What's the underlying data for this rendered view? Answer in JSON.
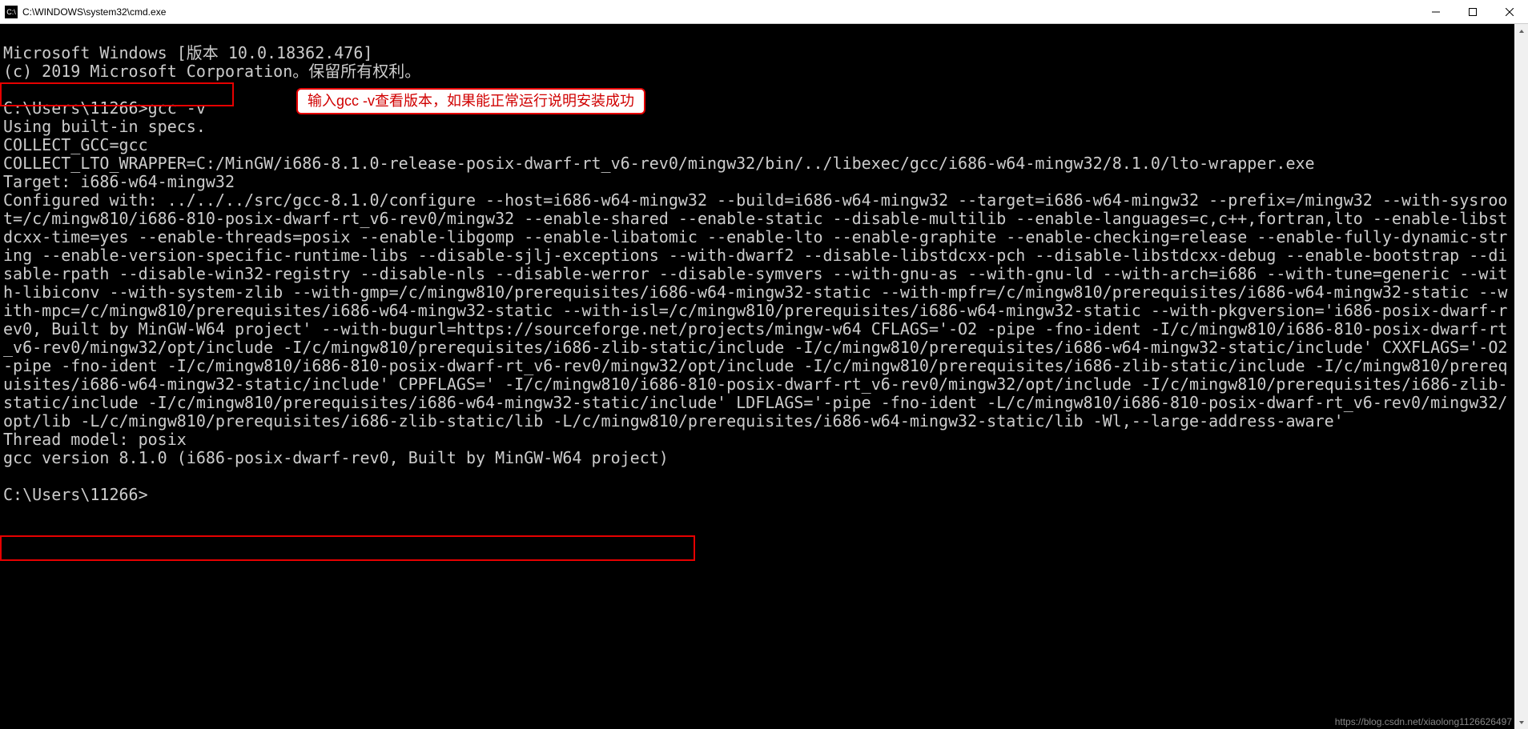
{
  "window": {
    "title": "C:\\WINDOWS\\system32\\cmd.exe",
    "icon_label": "C:\\"
  },
  "terminal": {
    "line_header1": "Microsoft Windows [版本 10.0.18362.476]",
    "line_header2": "(c) 2019 Microsoft Corporation。保留所有权利。",
    "blank": "",
    "prompt1": "C:\\Users\\11266>gcc -v",
    "specs": "Using built-in specs.",
    "collect_gcc": "COLLECT_GCC=gcc",
    "collect_lto": "COLLECT_LTO_WRAPPER=C:/MinGW/i686-8.1.0-release-posix-dwarf-rt_v6-rev0/mingw32/bin/../libexec/gcc/i686-w64-mingw32/8.1.0/lto-wrapper.exe",
    "target": "Target: i686-w64-mingw32",
    "configured": "Configured with: ../../../src/gcc-8.1.0/configure --host=i686-w64-mingw32 --build=i686-w64-mingw32 --target=i686-w64-mingw32 --prefix=/mingw32 --with-sysroot=/c/mingw810/i686-810-posix-dwarf-rt_v6-rev0/mingw32 --enable-shared --enable-static --disable-multilib --enable-languages=c,c++,fortran,lto --enable-libstdcxx-time=yes --enable-threads=posix --enable-libgomp --enable-libatomic --enable-lto --enable-graphite --enable-checking=release --enable-fully-dynamic-string --enable-version-specific-runtime-libs --disable-sjlj-exceptions --with-dwarf2 --disable-libstdcxx-pch --disable-libstdcxx-debug --enable-bootstrap --disable-rpath --disable-win32-registry --disable-nls --disable-werror --disable-symvers --with-gnu-as --with-gnu-ld --with-arch=i686 --with-tune=generic --with-libiconv --with-system-zlib --with-gmp=/c/mingw810/prerequisites/i686-w64-mingw32-static --with-mpfr=/c/mingw810/prerequisites/i686-w64-mingw32-static --with-mpc=/c/mingw810/prerequisites/i686-w64-mingw32-static --with-isl=/c/mingw810/prerequisites/i686-w64-mingw32-static --with-pkgversion='i686-posix-dwarf-rev0, Built by MinGW-W64 project' --with-bugurl=https://sourceforge.net/projects/mingw-w64 CFLAGS='-O2 -pipe -fno-ident -I/c/mingw810/i686-810-posix-dwarf-rt_v6-rev0/mingw32/opt/include -I/c/mingw810/prerequisites/i686-zlib-static/include -I/c/mingw810/prerequisites/i686-w64-mingw32-static/include' CXXFLAGS='-O2 -pipe -fno-ident -I/c/mingw810/i686-810-posix-dwarf-rt_v6-rev0/mingw32/opt/include -I/c/mingw810/prerequisites/i686-zlib-static/include -I/c/mingw810/prerequisites/i686-w64-mingw32-static/include' CPPFLAGS=' -I/c/mingw810/i686-810-posix-dwarf-rt_v6-rev0/mingw32/opt/include -I/c/mingw810/prerequisites/i686-zlib-static/include -I/c/mingw810/prerequisites/i686-w64-mingw32-static/include' LDFLAGS='-pipe -fno-ident -L/c/mingw810/i686-810-posix-dwarf-rt_v6-rev0/mingw32/opt/lib -L/c/mingw810/prerequisites/i686-zlib-static/lib -L/c/mingw810/prerequisites/i686-w64-mingw32-static/lib -Wl,--large-address-aware'",
    "thread_model": "Thread model: posix",
    "version": "gcc version 8.1.0 (i686-posix-dwarf-rev0, Built by MinGW-W64 project)",
    "prompt2": "C:\\Users\\11266>"
  },
  "annotation": {
    "text": "输入gcc -v查看版本，如果能正常运行说明安装成功"
  },
  "watermark": "https://blog.csdn.net/xiaolong1126626497"
}
